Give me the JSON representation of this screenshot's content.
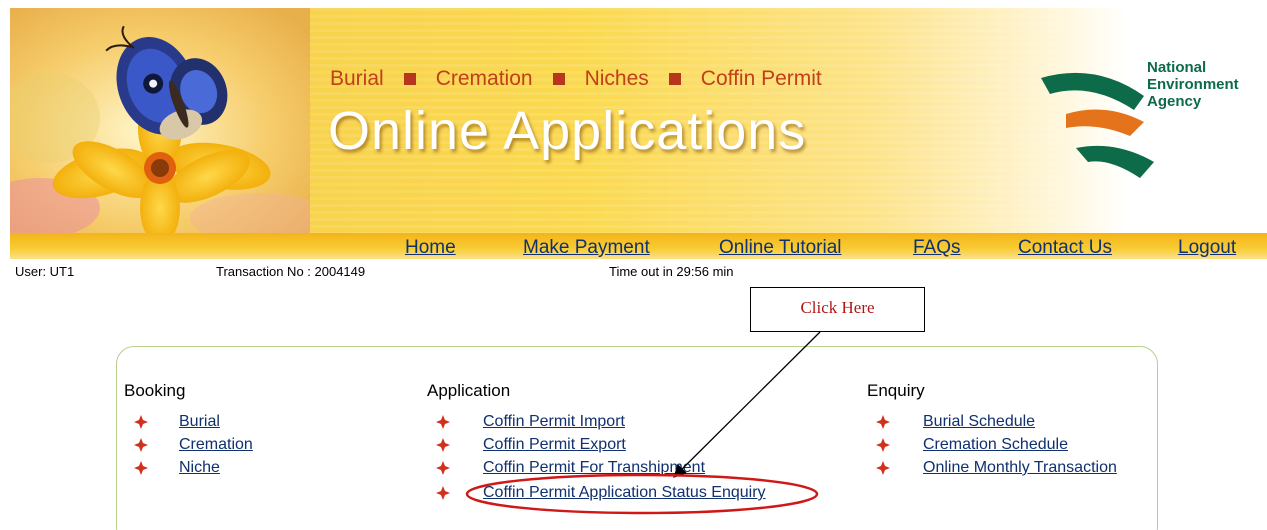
{
  "banner": {
    "categories": [
      "Burial",
      "Cremation",
      "Niches",
      "Coffin Permit"
    ],
    "title": "Online Applications",
    "agency_lines": [
      "National",
      "Environment",
      "Agency"
    ]
  },
  "nav": {
    "items": [
      "Home",
      "Make Payment",
      "Online Tutorial",
      "FAQs",
      "Contact Us",
      "Logout"
    ]
  },
  "info": {
    "user": "User: UT1",
    "transaction": "Transaction No : 2004149",
    "timeout": "Time out in 29:56 min"
  },
  "callout": {
    "text": "Click Here"
  },
  "menu": {
    "booking": {
      "heading": "Booking",
      "items": [
        "Burial",
        "Cremation",
        "Niche"
      ]
    },
    "application": {
      "heading": "Application",
      "items": [
        "Coffin Permit Import",
        "Coffin Permit Export",
        "Coffin Permit For Transhipment",
        "Coffin Permit Application Status Enquiry"
      ]
    },
    "enquiry": {
      "heading": "Enquiry",
      "items": [
        "Burial Schedule",
        "Cremation Schedule",
        "Online Monthly Transaction"
      ]
    }
  },
  "colors": {
    "link": "#10306e",
    "highlight": "#d01818",
    "bullet": "#d0301c",
    "agency_green": "#0e6b4a",
    "agency_orange": "#e5731c"
  }
}
